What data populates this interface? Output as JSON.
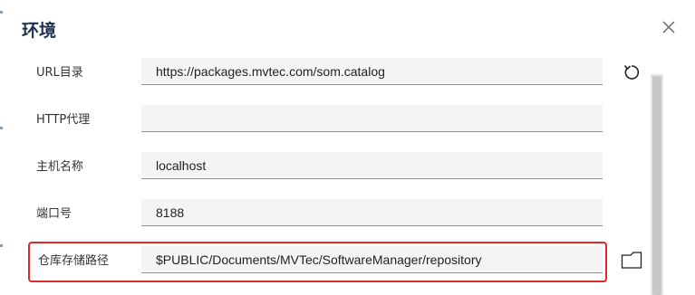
{
  "dialog": {
    "title": "环境",
    "close_icon": "close-icon"
  },
  "fields": {
    "url_catalog": {
      "label": "URL目录",
      "value": "https://packages.mvtec.com/som.catalog",
      "action_icon": "refresh-icon"
    },
    "http_proxy": {
      "label": "HTTP代理",
      "value": ""
    },
    "hostname": {
      "label": "主机名称",
      "value": "localhost"
    },
    "port": {
      "label": "端口号",
      "value": "8188"
    },
    "repository_path": {
      "label": "仓库存储路径",
      "value": "$PUBLIC/Documents/MVTec/SoftwareManager/repository",
      "action_icon": "folder-icon"
    }
  },
  "colors": {
    "title": "#1e3050",
    "highlight": "#e02a2a",
    "field_bg": "#f4f4f4",
    "field_underline": "#8e8e8e"
  }
}
